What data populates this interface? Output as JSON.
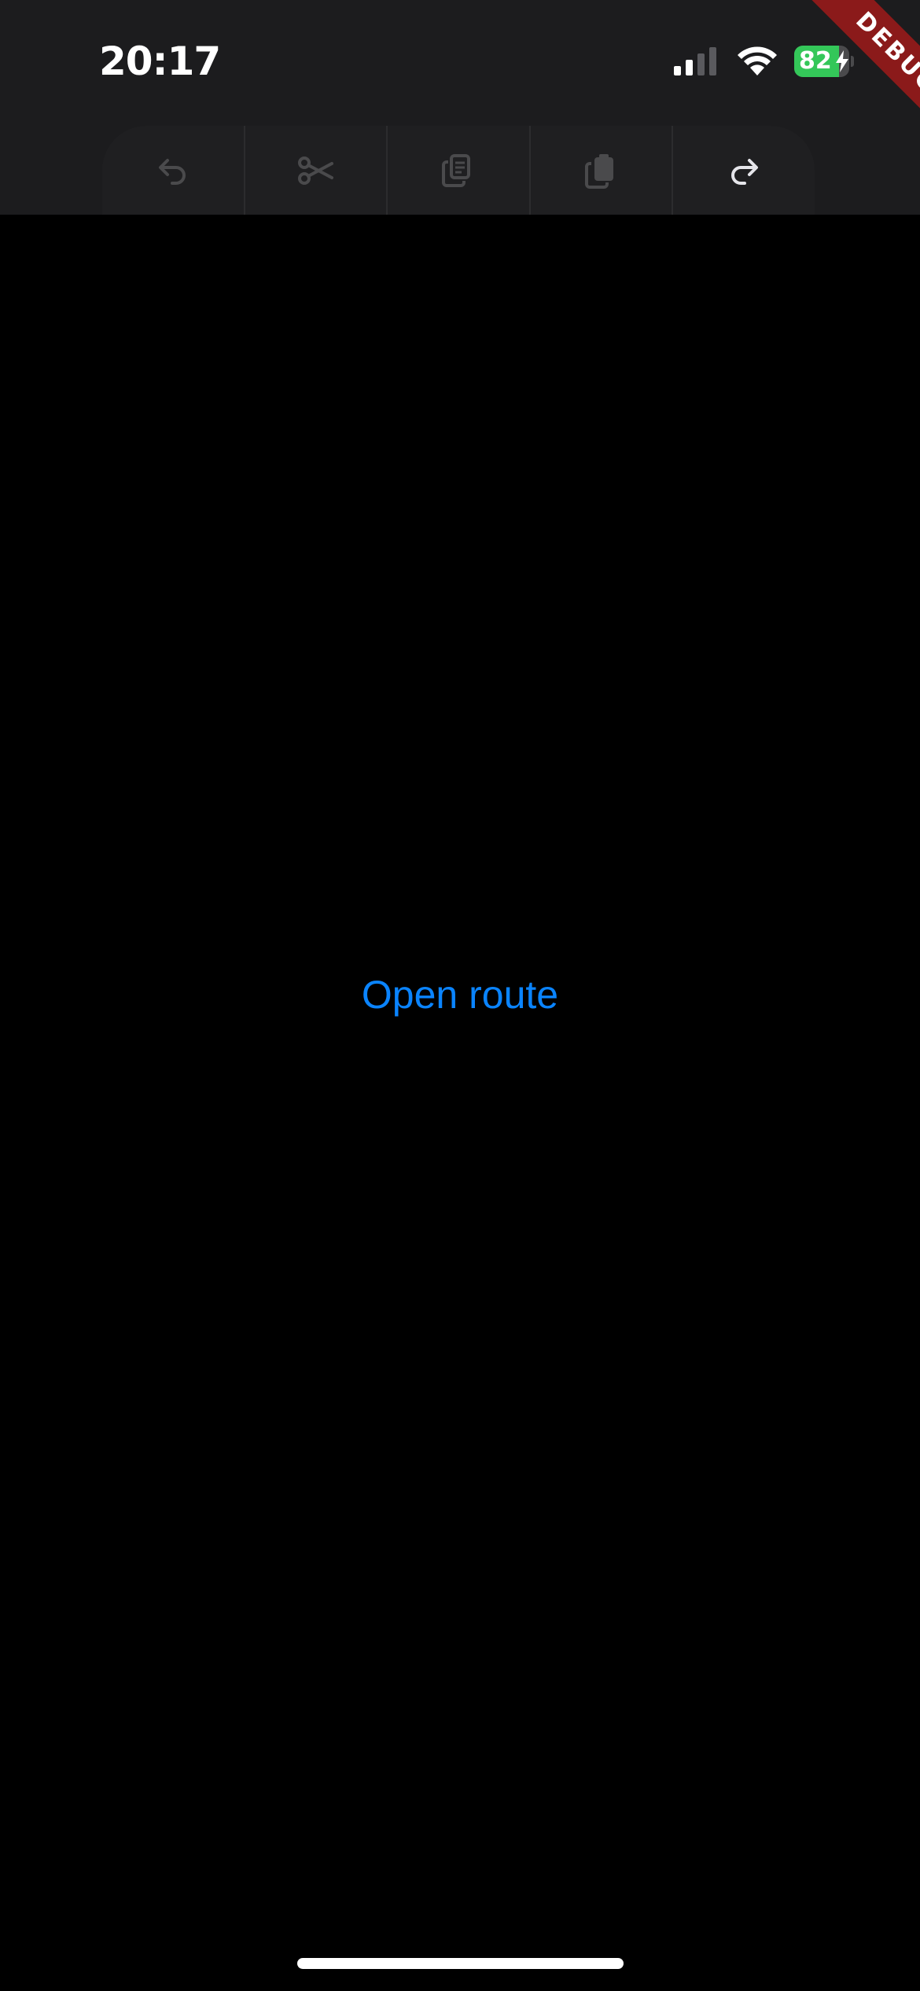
{
  "status_bar": {
    "time": "20:17",
    "battery_level": "82",
    "battery_fraction": 0.82,
    "signal_bars_active": 2,
    "icons": [
      "signal-icon",
      "wifi-icon",
      "battery-icon",
      "charging-bolt-icon"
    ]
  },
  "debug_banner": {
    "label": "DEBUG",
    "color": "#8b1a1a"
  },
  "edit_toolbar": {
    "buttons": [
      {
        "name": "undo-button",
        "icon": "undo-icon",
        "enabled": false
      },
      {
        "name": "cut-button",
        "icon": "scissors-icon",
        "enabled": false
      },
      {
        "name": "copy-button",
        "icon": "copy-icon",
        "enabled": false
      },
      {
        "name": "paste-button",
        "icon": "paste-icon",
        "enabled": false
      },
      {
        "name": "redo-button",
        "icon": "redo-icon",
        "enabled": true
      }
    ]
  },
  "main": {
    "link_label": "Open route"
  },
  "colors": {
    "background": "#000000",
    "bar_background": "#1c1c1e",
    "accent": "#0a84ff",
    "battery_green": "#34c759",
    "disabled_icon": "#4a4a4c",
    "enabled_icon": "#e5e5ea"
  }
}
